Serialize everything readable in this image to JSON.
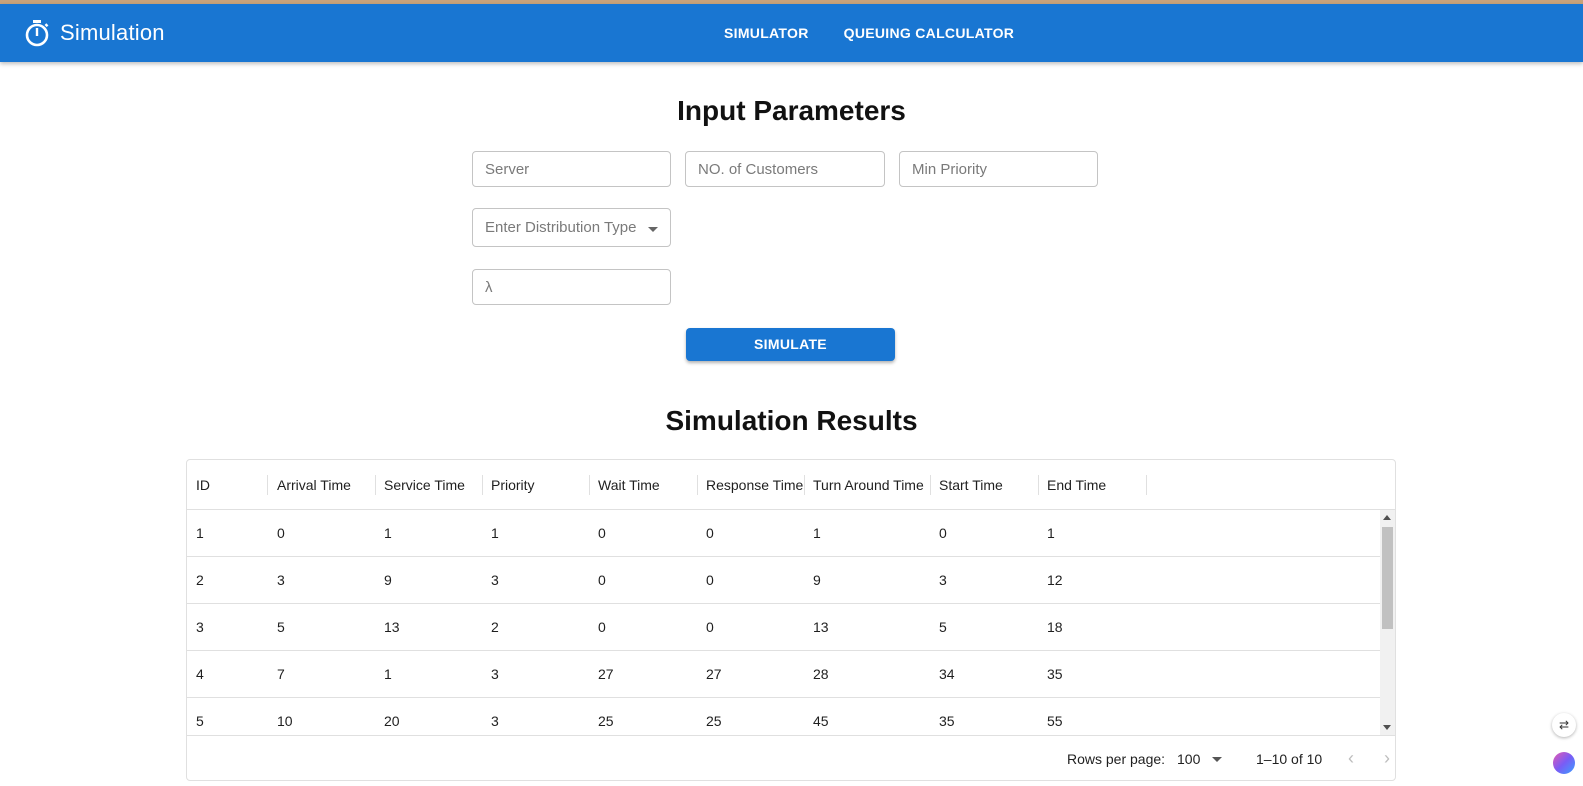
{
  "app": {
    "title": "Simulation",
    "logo_icon": "stopwatch-icon"
  },
  "nav": {
    "simulator": "SIMULATOR",
    "queuing_calculator": "QUEUING CALCULATOR"
  },
  "input_section": {
    "title": "Input Parameters",
    "server_placeholder": "Server",
    "customers_placeholder": "NO. of Customers",
    "min_priority_placeholder": "Min Priority",
    "distribution_placeholder": "Enter Distribution Type",
    "lambda_placeholder": "λ",
    "simulate_label": "SIMULATE"
  },
  "results_section": {
    "title": "Simulation Results",
    "columns": [
      "ID",
      "Arrival Time",
      "Service Time",
      "Priority",
      "Wait Time",
      "Response Time",
      "Turn Around Time",
      "Start Time",
      "End Time"
    ],
    "rows": [
      [
        "1",
        "0",
        "1",
        "1",
        "0",
        "0",
        "1",
        "0",
        "1"
      ],
      [
        "2",
        "3",
        "9",
        "3",
        "0",
        "0",
        "9",
        "3",
        "12"
      ],
      [
        "3",
        "5",
        "13",
        "2",
        "0",
        "0",
        "13",
        "5",
        "18"
      ],
      [
        "4",
        "7",
        "1",
        "3",
        "27",
        "27",
        "28",
        "34",
        "35"
      ],
      [
        "5",
        "10",
        "20",
        "3",
        "25",
        "25",
        "45",
        "35",
        "55"
      ]
    ],
    "footer": {
      "rows_per_page_label": "Rows per page:",
      "rows_per_page_value": "100",
      "range": "1–10 of 10"
    }
  },
  "colors": {
    "primary": "#1976d2",
    "top_strip": "#c9a27a"
  }
}
